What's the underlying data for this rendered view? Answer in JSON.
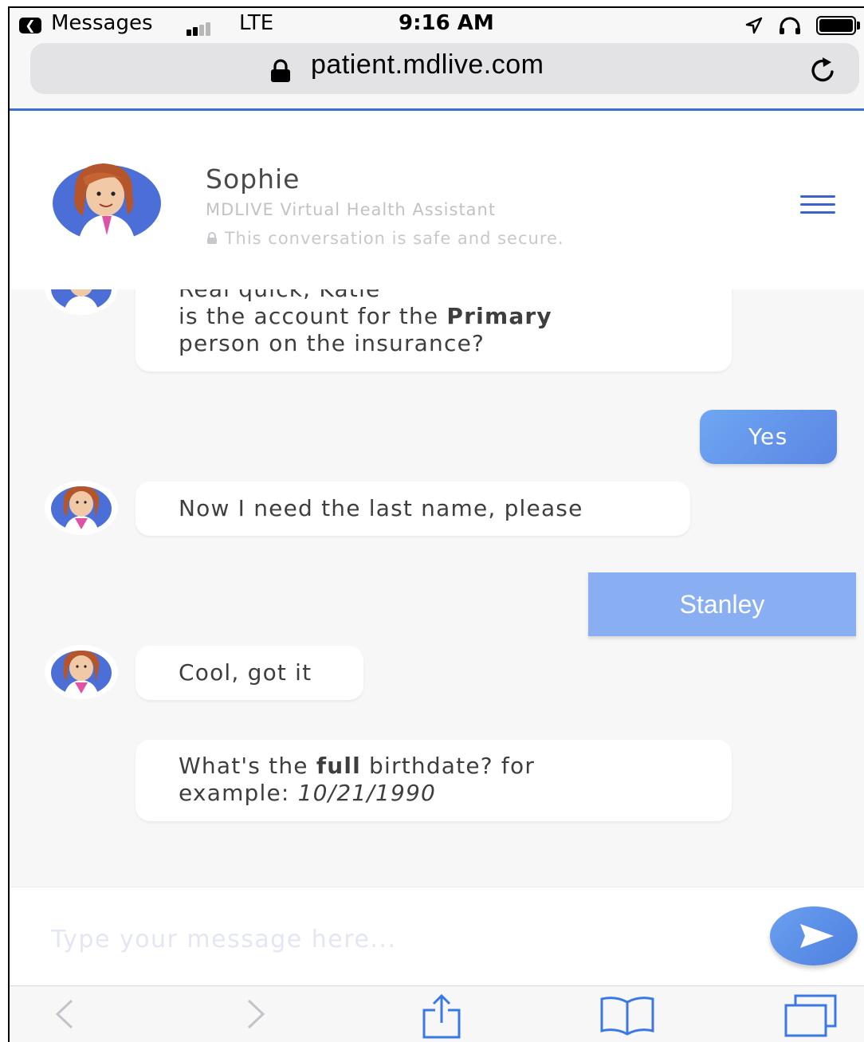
{
  "status_bar": {
    "back_app": "Messages",
    "carrier": "LTE",
    "time": "9:16 AM",
    "icons": [
      "signal-icon",
      "location-arrow-icon",
      "headphones-icon",
      "battery-icon"
    ]
  },
  "url_bar": {
    "url": "patient.mdlive.com",
    "icons": [
      "lock-icon",
      "reload-icon"
    ]
  },
  "chat_header": {
    "name": "Sophie",
    "role": "MDLIVE Virtual Health Assistant",
    "secure_note": "This conversation is safe and secure."
  },
  "messages": {
    "m1": {
      "line0": "Real quick, Katie",
      "line1_pre": "is the account for the ",
      "line1_bold": "Primary",
      "line2": "person on the insurance?"
    },
    "m2": "Yes",
    "m3": "Now I need the last name, please",
    "m4": "Stanley",
    "m5": "Cool, got it",
    "m6": {
      "pre": "What's the ",
      "bold": "full",
      "post": " birthdate? for",
      "line2_pre": "example: ",
      "line2_italic": "10/21/1990"
    }
  },
  "input": {
    "placeholder": "Type your message here...",
    "value": ""
  },
  "toolbar": {
    "items": [
      "back-icon",
      "forward-icon",
      "share-icon",
      "bookmarks-icon",
      "tabs-icon"
    ]
  },
  "colors": {
    "accent": "#3b63c8",
    "user_bubble_gradient_start": "#6fa6f2",
    "user_bubble_gradient_end": "#5a86e3",
    "user_bubble_flat": "#8aaef2",
    "background": "#f7f7f8"
  }
}
